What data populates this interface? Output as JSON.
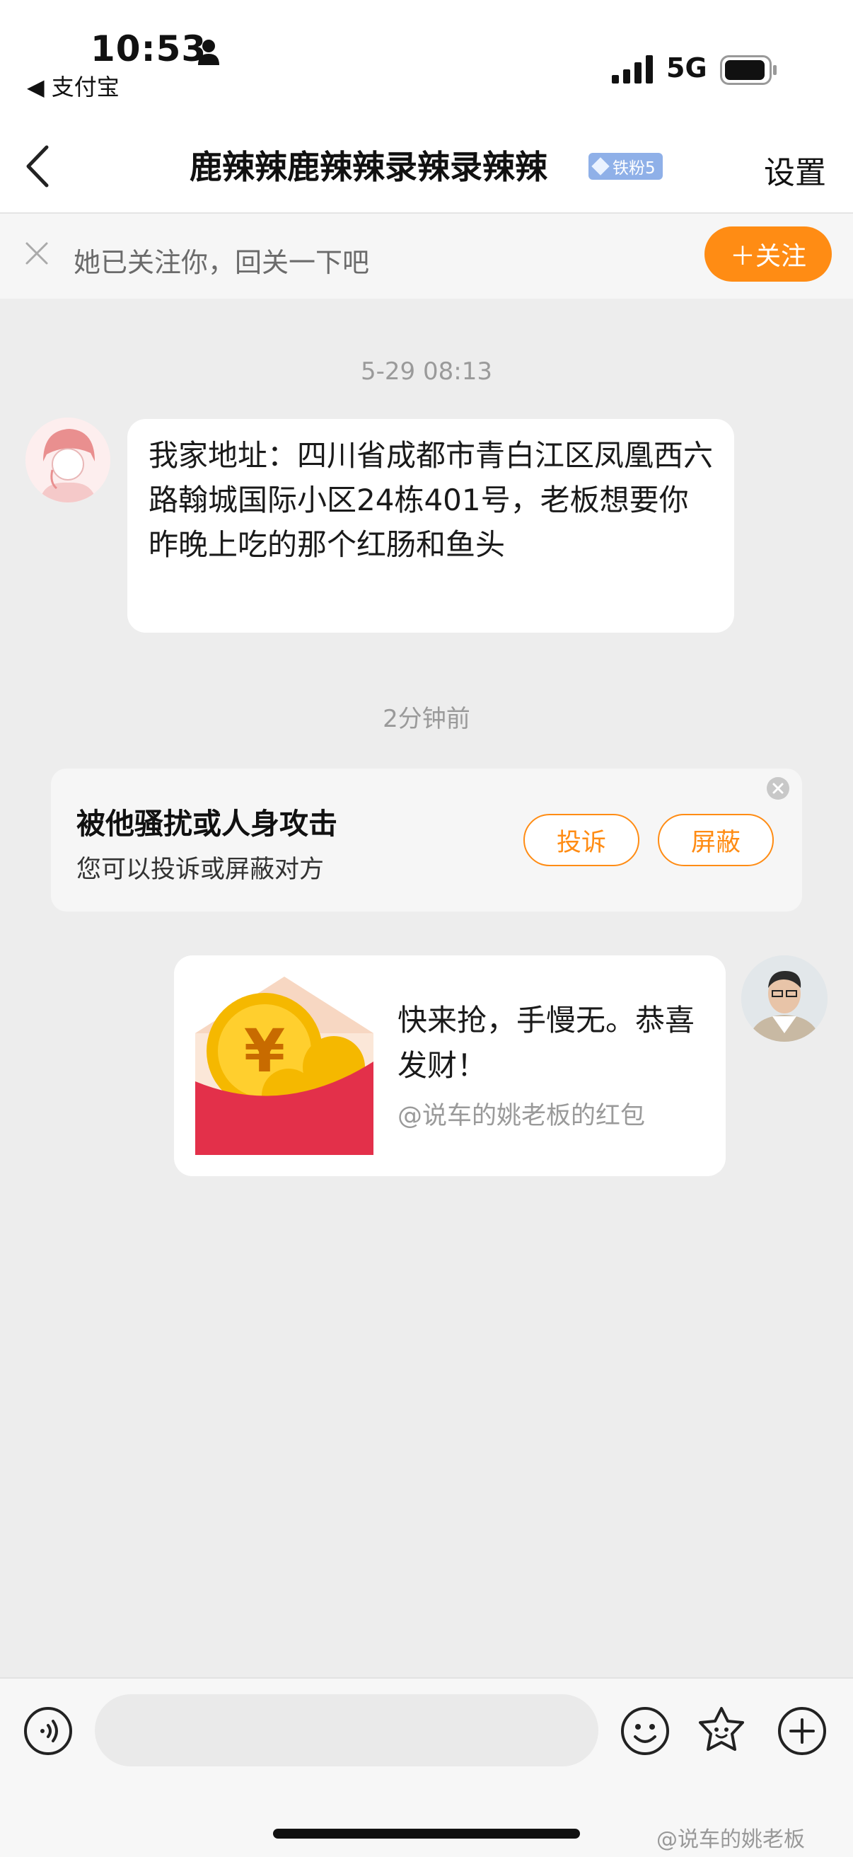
{
  "status_bar": {
    "time": "10:53",
    "back_app": "◀ 支付宝",
    "network": "5G"
  },
  "header": {
    "title": "鹿辣辣鹿辣辣录辣录辣辣",
    "fan_badge": "铁粉5",
    "settings": "设置"
  },
  "follow_bar": {
    "text": "她已关注你，回关一下吧",
    "button": "＋关注"
  },
  "messages": {
    "timestamp_1": "5-29 08:13",
    "received_text": "我家地址：四川省成都市青白江区凤凰西六路翰城国际小区24栋401号，老板想要你昨晚上吃的那个红肠和鱼头",
    "timestamp_2": "2分钟前",
    "harass_title": "被他骚扰或人身攻击",
    "harass_sub": "您可以投诉或屏蔽对方",
    "complain_button": "投诉",
    "block_button": "屏蔽",
    "red_packet_text": "快来抢，手慢无。恭喜发财！",
    "red_packet_sub": "@说车的姚老板的红包"
  },
  "input": {
    "placeholder": ""
  },
  "watermark": "@说车的姚老板",
  "colors": {
    "accent": "#ff8c14",
    "red_packet": "#e3304a",
    "coin": "#f5b800"
  }
}
